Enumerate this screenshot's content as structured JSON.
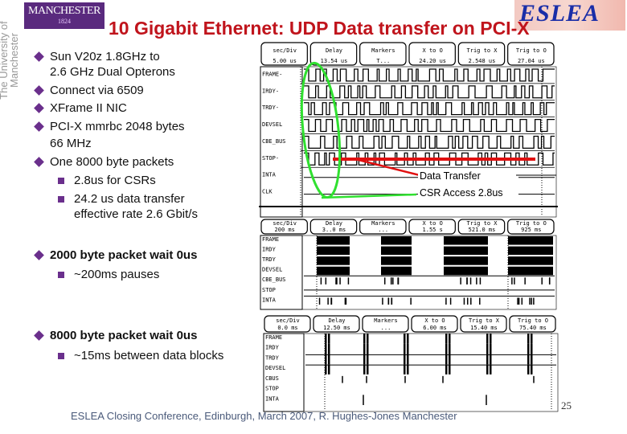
{
  "logos": {
    "manchester": "MANCHESTER",
    "manchester_year": "1824",
    "university": "The University of Manchester",
    "esla": "ESLEA"
  },
  "title": "10 Gigabit Ethernet: UDP Data transfer on PCI-X",
  "bullets": [
    {
      "level": 1,
      "text": "Sun V20z 1.8GHz to"
    },
    {
      "level": 1,
      "cont": true,
      "text": "2.6 GHz Dual Opterons"
    },
    {
      "level": 1,
      "text": "Connect via 6509"
    },
    {
      "level": 1,
      "text": "XFrame II NIC"
    },
    {
      "level": 1,
      "text": "PCI-X mmrbc 2048 bytes"
    },
    {
      "level": 1,
      "cont": true,
      "text": "66 MHz"
    },
    {
      "level": 1,
      "text": "One 8000 byte packets"
    },
    {
      "level": 2,
      "text": "2.8us for CSRs"
    },
    {
      "level": 2,
      "text": "24.2 us data transfer"
    },
    {
      "level": 2,
      "cont": true,
      "text": "effective rate 2.6 Gbit/s"
    }
  ],
  "section2": {
    "bullet": "2000 byte packet wait 0us",
    "sub": "~200ms pauses"
  },
  "section3": {
    "bullet": "8000 byte packet wait 0us",
    "sub": "~15ms between data blocks"
  },
  "scope1": {
    "buttons": [
      [
        "sec/Div",
        "5.00 us"
      ],
      [
        "Delay",
        "13.54 us"
      ],
      [
        "Markers",
        "T..."
      ],
      [
        "X to O",
        "24.20 us"
      ],
      [
        "Trig to X",
        "2.548 us"
      ],
      [
        "Trig to O",
        "27.04 us"
      ]
    ],
    "channels": [
      "FRAME-",
      "IRDY-",
      "TRDY-",
      "DEVSEL",
      "CBE_BUS",
      "STOP-",
      "INTA",
      "CLK"
    ],
    "annotations": {
      "data_transfer": "Data Transfer",
      "csr_access": "CSR Access 2.8us"
    },
    "colors": {
      "data_transfer": "#e01010",
      "csr_access": "#30e030"
    }
  },
  "scope2": {
    "buttons": [
      [
        "sec/Div",
        "200 ms"
      ],
      [
        "Delay",
        "3..0 ms"
      ],
      [
        "Markers",
        "..."
      ],
      [
        "X to O",
        "1.55 s"
      ],
      [
        "Trig to X",
        "521.0 ms"
      ],
      [
        "Trig to O",
        "925 ms"
      ]
    ],
    "channels": [
      "FRAME",
      "IRDY",
      "TRDY",
      "DEVSEL",
      "CBE_BUS",
      "STOP",
      "INTA"
    ]
  },
  "scope3": {
    "buttons": [
      [
        "sec/Div",
        "0.0 ms"
      ],
      [
        "Delay",
        "12.50 ms"
      ],
      [
        "Markers",
        "..."
      ],
      [
        "X to O",
        "6.00 ms"
      ],
      [
        "Trig to X",
        "15.40 ms"
      ],
      [
        "Trig to O",
        "75.40 ms"
      ]
    ],
    "channels": [
      "FRAME",
      "IRDY",
      "TRDY",
      "DEVSEL",
      "CBUS",
      "STOP",
      "INTA"
    ]
  },
  "footer": "ESLEA Closing Conference, Edinburgh, March 2007,  R. Hughes-Jones  Manchester",
  "page_number": "25",
  "colors": {
    "title": "#c0141c",
    "bullet": "#6a2f8c",
    "footer": "#4a5a7a"
  }
}
